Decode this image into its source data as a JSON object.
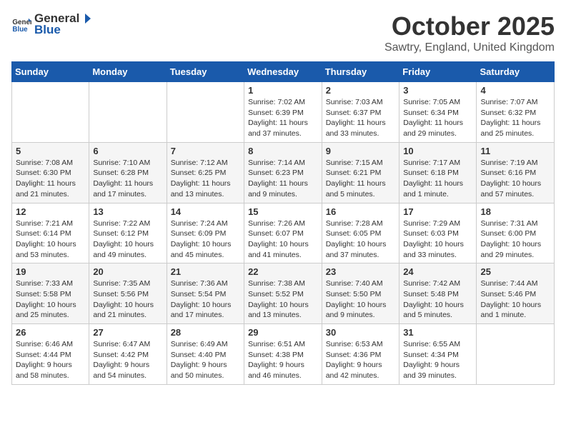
{
  "logo": {
    "general": "General",
    "blue": "Blue"
  },
  "title": "October 2025",
  "location": "Sawtry, England, United Kingdom",
  "days_header": [
    "Sunday",
    "Monday",
    "Tuesday",
    "Wednesday",
    "Thursday",
    "Friday",
    "Saturday"
  ],
  "weeks": [
    [
      {
        "day": "",
        "info": ""
      },
      {
        "day": "",
        "info": ""
      },
      {
        "day": "",
        "info": ""
      },
      {
        "day": "1",
        "info": "Sunrise: 7:02 AM\nSunset: 6:39 PM\nDaylight: 11 hours\nand 37 minutes."
      },
      {
        "day": "2",
        "info": "Sunrise: 7:03 AM\nSunset: 6:37 PM\nDaylight: 11 hours\nand 33 minutes."
      },
      {
        "day": "3",
        "info": "Sunrise: 7:05 AM\nSunset: 6:34 PM\nDaylight: 11 hours\nand 29 minutes."
      },
      {
        "day": "4",
        "info": "Sunrise: 7:07 AM\nSunset: 6:32 PM\nDaylight: 11 hours\nand 25 minutes."
      }
    ],
    [
      {
        "day": "5",
        "info": "Sunrise: 7:08 AM\nSunset: 6:30 PM\nDaylight: 11 hours\nand 21 minutes."
      },
      {
        "day": "6",
        "info": "Sunrise: 7:10 AM\nSunset: 6:28 PM\nDaylight: 11 hours\nand 17 minutes."
      },
      {
        "day": "7",
        "info": "Sunrise: 7:12 AM\nSunset: 6:25 PM\nDaylight: 11 hours\nand 13 minutes."
      },
      {
        "day": "8",
        "info": "Sunrise: 7:14 AM\nSunset: 6:23 PM\nDaylight: 11 hours\nand 9 minutes."
      },
      {
        "day": "9",
        "info": "Sunrise: 7:15 AM\nSunset: 6:21 PM\nDaylight: 11 hours\nand 5 minutes."
      },
      {
        "day": "10",
        "info": "Sunrise: 7:17 AM\nSunset: 6:18 PM\nDaylight: 11 hours\nand 1 minute."
      },
      {
        "day": "11",
        "info": "Sunrise: 7:19 AM\nSunset: 6:16 PM\nDaylight: 10 hours\nand 57 minutes."
      }
    ],
    [
      {
        "day": "12",
        "info": "Sunrise: 7:21 AM\nSunset: 6:14 PM\nDaylight: 10 hours\nand 53 minutes."
      },
      {
        "day": "13",
        "info": "Sunrise: 7:22 AM\nSunset: 6:12 PM\nDaylight: 10 hours\nand 49 minutes."
      },
      {
        "day": "14",
        "info": "Sunrise: 7:24 AM\nSunset: 6:09 PM\nDaylight: 10 hours\nand 45 minutes."
      },
      {
        "day": "15",
        "info": "Sunrise: 7:26 AM\nSunset: 6:07 PM\nDaylight: 10 hours\nand 41 minutes."
      },
      {
        "day": "16",
        "info": "Sunrise: 7:28 AM\nSunset: 6:05 PM\nDaylight: 10 hours\nand 37 minutes."
      },
      {
        "day": "17",
        "info": "Sunrise: 7:29 AM\nSunset: 6:03 PM\nDaylight: 10 hours\nand 33 minutes."
      },
      {
        "day": "18",
        "info": "Sunrise: 7:31 AM\nSunset: 6:00 PM\nDaylight: 10 hours\nand 29 minutes."
      }
    ],
    [
      {
        "day": "19",
        "info": "Sunrise: 7:33 AM\nSunset: 5:58 PM\nDaylight: 10 hours\nand 25 minutes."
      },
      {
        "day": "20",
        "info": "Sunrise: 7:35 AM\nSunset: 5:56 PM\nDaylight: 10 hours\nand 21 minutes."
      },
      {
        "day": "21",
        "info": "Sunrise: 7:36 AM\nSunset: 5:54 PM\nDaylight: 10 hours\nand 17 minutes."
      },
      {
        "day": "22",
        "info": "Sunrise: 7:38 AM\nSunset: 5:52 PM\nDaylight: 10 hours\nand 13 minutes."
      },
      {
        "day": "23",
        "info": "Sunrise: 7:40 AM\nSunset: 5:50 PM\nDaylight: 10 hours\nand 9 minutes."
      },
      {
        "day": "24",
        "info": "Sunrise: 7:42 AM\nSunset: 5:48 PM\nDaylight: 10 hours\nand 5 minutes."
      },
      {
        "day": "25",
        "info": "Sunrise: 7:44 AM\nSunset: 5:46 PM\nDaylight: 10 hours\nand 1 minute."
      }
    ],
    [
      {
        "day": "26",
        "info": "Sunrise: 6:46 AM\nSunset: 4:44 PM\nDaylight: 9 hours\nand 58 minutes."
      },
      {
        "day": "27",
        "info": "Sunrise: 6:47 AM\nSunset: 4:42 PM\nDaylight: 9 hours\nand 54 minutes."
      },
      {
        "day": "28",
        "info": "Sunrise: 6:49 AM\nSunset: 4:40 PM\nDaylight: 9 hours\nand 50 minutes."
      },
      {
        "day": "29",
        "info": "Sunrise: 6:51 AM\nSunset: 4:38 PM\nDaylight: 9 hours\nand 46 minutes."
      },
      {
        "day": "30",
        "info": "Sunrise: 6:53 AM\nSunset: 4:36 PM\nDaylight: 9 hours\nand 42 minutes."
      },
      {
        "day": "31",
        "info": "Sunrise: 6:55 AM\nSunset: 4:34 PM\nDaylight: 9 hours\nand 39 minutes."
      },
      {
        "day": "",
        "info": ""
      }
    ]
  ]
}
